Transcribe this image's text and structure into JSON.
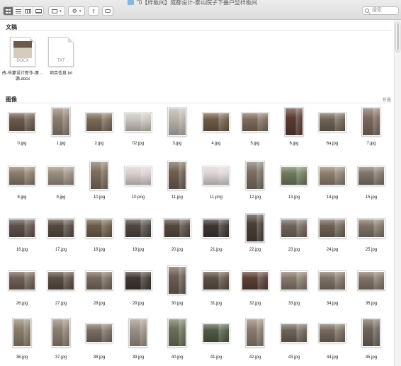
{
  "window": {
    "title": "\"0【样板间】成都设计-泰山院子下叠户型样板间"
  },
  "toolbar": {
    "view_icons": [
      "icon-view-icon",
      "list-view-icon",
      "column-view-icon",
      "gallery-view-icon"
    ],
    "group_icon": "group-by-icon",
    "action_icon": "gear-icon",
    "share_icon": "share-icon",
    "tag_icon": "tag-icon",
    "search_placeholder": "搜索"
  },
  "documents": {
    "title": "文稿",
    "items": [
      {
        "name": "改-岳蒙设计新作-摩…源.docx",
        "badge": "DOCX"
      },
      {
        "name": "项目信息.txt",
        "badge": "TXT"
      }
    ]
  },
  "images": {
    "title": "图像",
    "collapse_label": "折叠",
    "items": [
      {
        "name": "0.jpg",
        "tone": "#6b5a4c"
      },
      {
        "name": "1.jpg",
        "tone": "#8c7f70"
      },
      {
        "name": "2.jpg",
        "tone": "#7a6a58"
      },
      {
        "name": "02.jpg",
        "tone": "#c9c4bd"
      },
      {
        "name": "3.jpg",
        "tone": "#b9b3ac"
      },
      {
        "name": "4.jpg",
        "tone": "#6e5b47"
      },
      {
        "name": "5.jpg",
        "tone": "#7d6b5a"
      },
      {
        "name": "6.jpg",
        "tone": "#5b3b33"
      },
      {
        "name": "6a.jpg",
        "tone": "#6f6356"
      },
      {
        "name": "7.jpg",
        "tone": "#7b6a5e"
      },
      {
        "name": "8.jpg",
        "tone": "#8b7b6a"
      },
      {
        "name": "9.jpg",
        "tone": "#9a8d7f"
      },
      {
        "name": "10.jpg",
        "tone": "#7d6d5d"
      },
      {
        "name": "10.png",
        "tone": "#d8d0cf"
      },
      {
        "name": "11.jpg",
        "tone": "#6f5f50"
      },
      {
        "name": "11.png",
        "tone": "#dcd4d4"
      },
      {
        "name": "12.jpg",
        "tone": "#7a6f62"
      },
      {
        "name": "13.jpg",
        "tone": "#6e7a5c"
      },
      {
        "name": "14.jpg",
        "tone": "#8d7e6e"
      },
      {
        "name": "15.jpg",
        "tone": "#7f7468"
      },
      {
        "name": "16.jpg",
        "tone": "#5e514a"
      },
      {
        "name": "17.jpg",
        "tone": "#564a40"
      },
      {
        "name": "18.jpg",
        "tone": "#6c5d4a"
      },
      {
        "name": "19.jpg",
        "tone": "#4f4740"
      },
      {
        "name": "20.jpg",
        "tone": "#55493f"
      },
      {
        "name": "21.jpg",
        "tone": "#3d3632"
      },
      {
        "name": "22.jpg",
        "tone": "#4a3f38"
      },
      {
        "name": "23.jpg",
        "tone": "#70655a"
      },
      {
        "name": "24.jpg",
        "tone": "#6f6256"
      },
      {
        "name": "25.jpg",
        "tone": "#7f7266"
      },
      {
        "name": "26.jpg",
        "tone": "#6f6053"
      },
      {
        "name": "27.jpg",
        "tone": "#5a4d43"
      },
      {
        "name": "28.jpg",
        "tone": "#76695c"
      },
      {
        "name": "29.jpg",
        "tone": "#3f3732"
      },
      {
        "name": "30.jpg",
        "tone": "#6b5e52"
      },
      {
        "name": "31.jpg",
        "tone": "#5d4f43"
      },
      {
        "name": "32.jpg",
        "tone": "#5a3e35"
      },
      {
        "name": "33.jpg",
        "tone": "#85786a"
      },
      {
        "name": "34.jpg",
        "tone": "#7f7264"
      },
      {
        "name": "35.jpg",
        "tone": "#827567"
      },
      {
        "name": "36.jpg",
        "tone": "#8b7d6b"
      },
      {
        "name": "37.jpg",
        "tone": "#8c8072"
      },
      {
        "name": "38.jpg",
        "tone": "#7a6d61"
      },
      {
        "name": "39.jpg",
        "tone": "#9b9185"
      },
      {
        "name": "40.jpg",
        "tone": "#6a7058"
      },
      {
        "name": "41.jpg",
        "tone": "#4f5a44"
      },
      {
        "name": "42.jpg",
        "tone": "#8a7d70"
      },
      {
        "name": "43.jpg",
        "tone": "#6e6358"
      },
      {
        "name": "44.jpg",
        "tone": "#76695d"
      },
      {
        "name": "45.jpg",
        "tone": "#6e655c"
      }
    ]
  }
}
